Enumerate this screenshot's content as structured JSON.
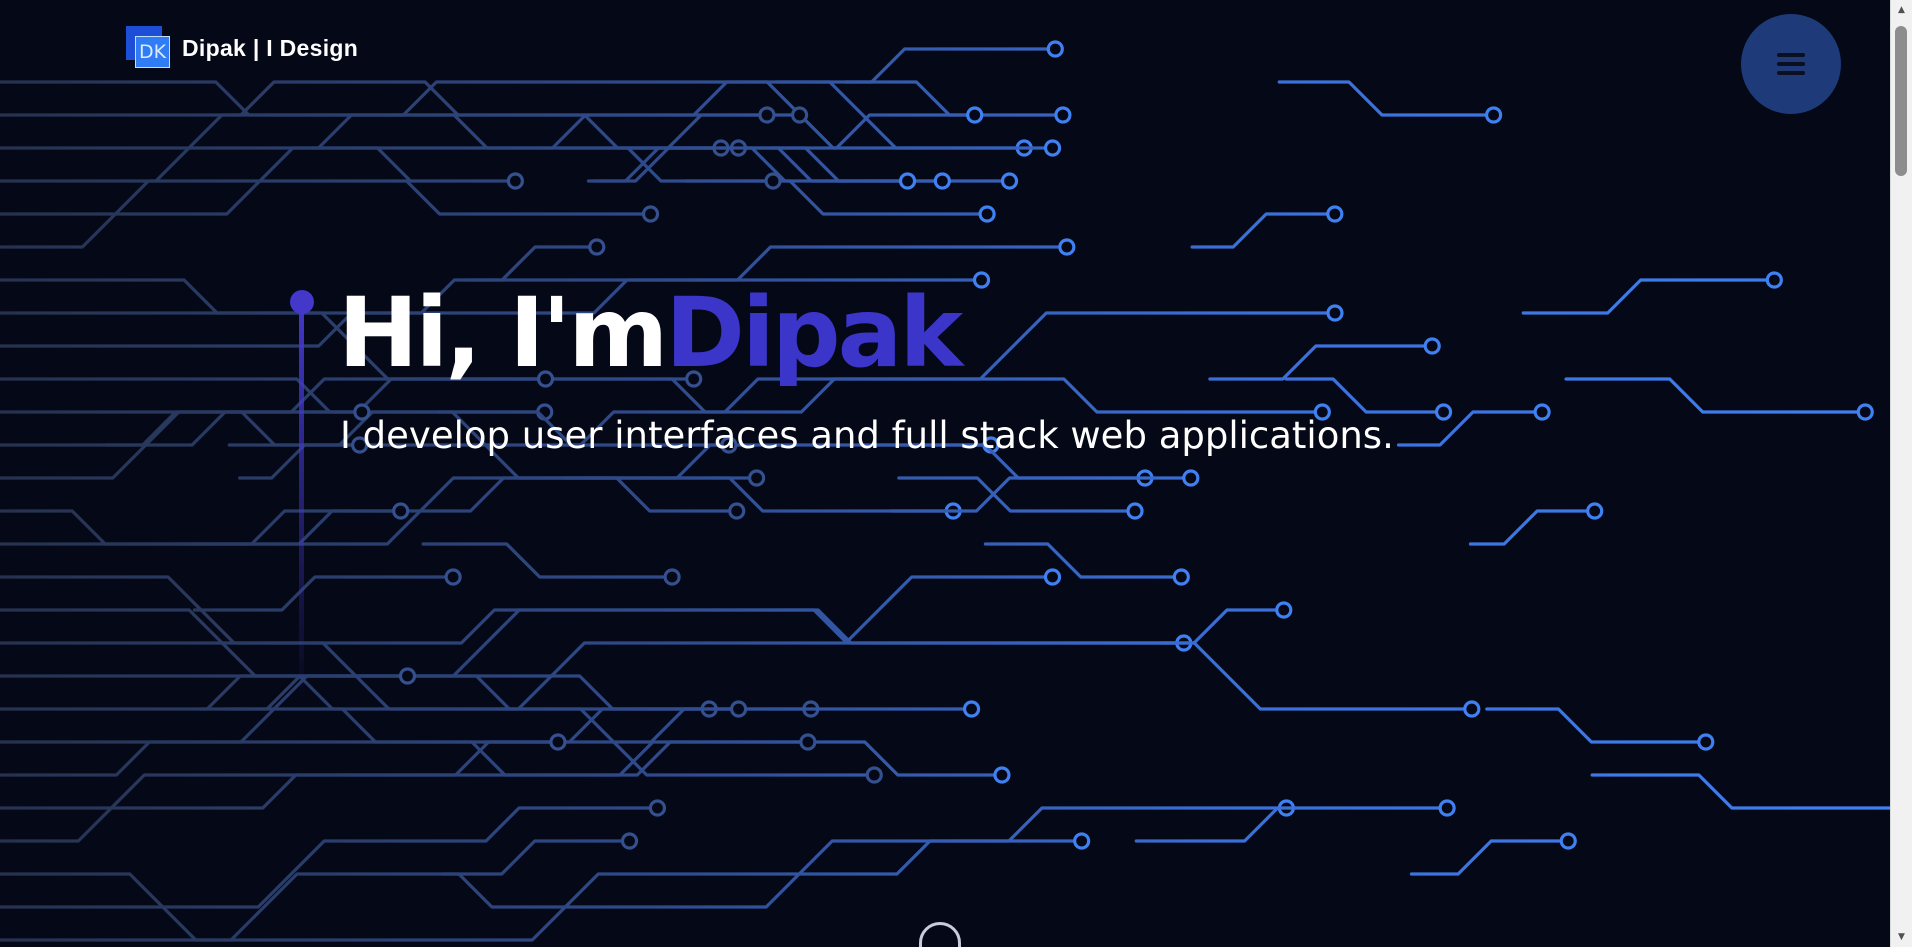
{
  "brand": {
    "logo_text": "DK",
    "name": "Dipak | I Design"
  },
  "hero": {
    "title_prefix": "Hi, I'm",
    "title_name": "Dipak",
    "subtitle": "I develop user interfaces and full stack web applications."
  },
  "icons": {
    "menu": "hamburger-menu-icon",
    "scroll": "mouse-scroll-icon"
  },
  "colors": {
    "background": "#050816",
    "accent_name": "#3b35c9",
    "circuit_trace_right": "#3b82f6",
    "circuit_trace_left": "#334a7a",
    "menu_button": "#1e3a78"
  }
}
